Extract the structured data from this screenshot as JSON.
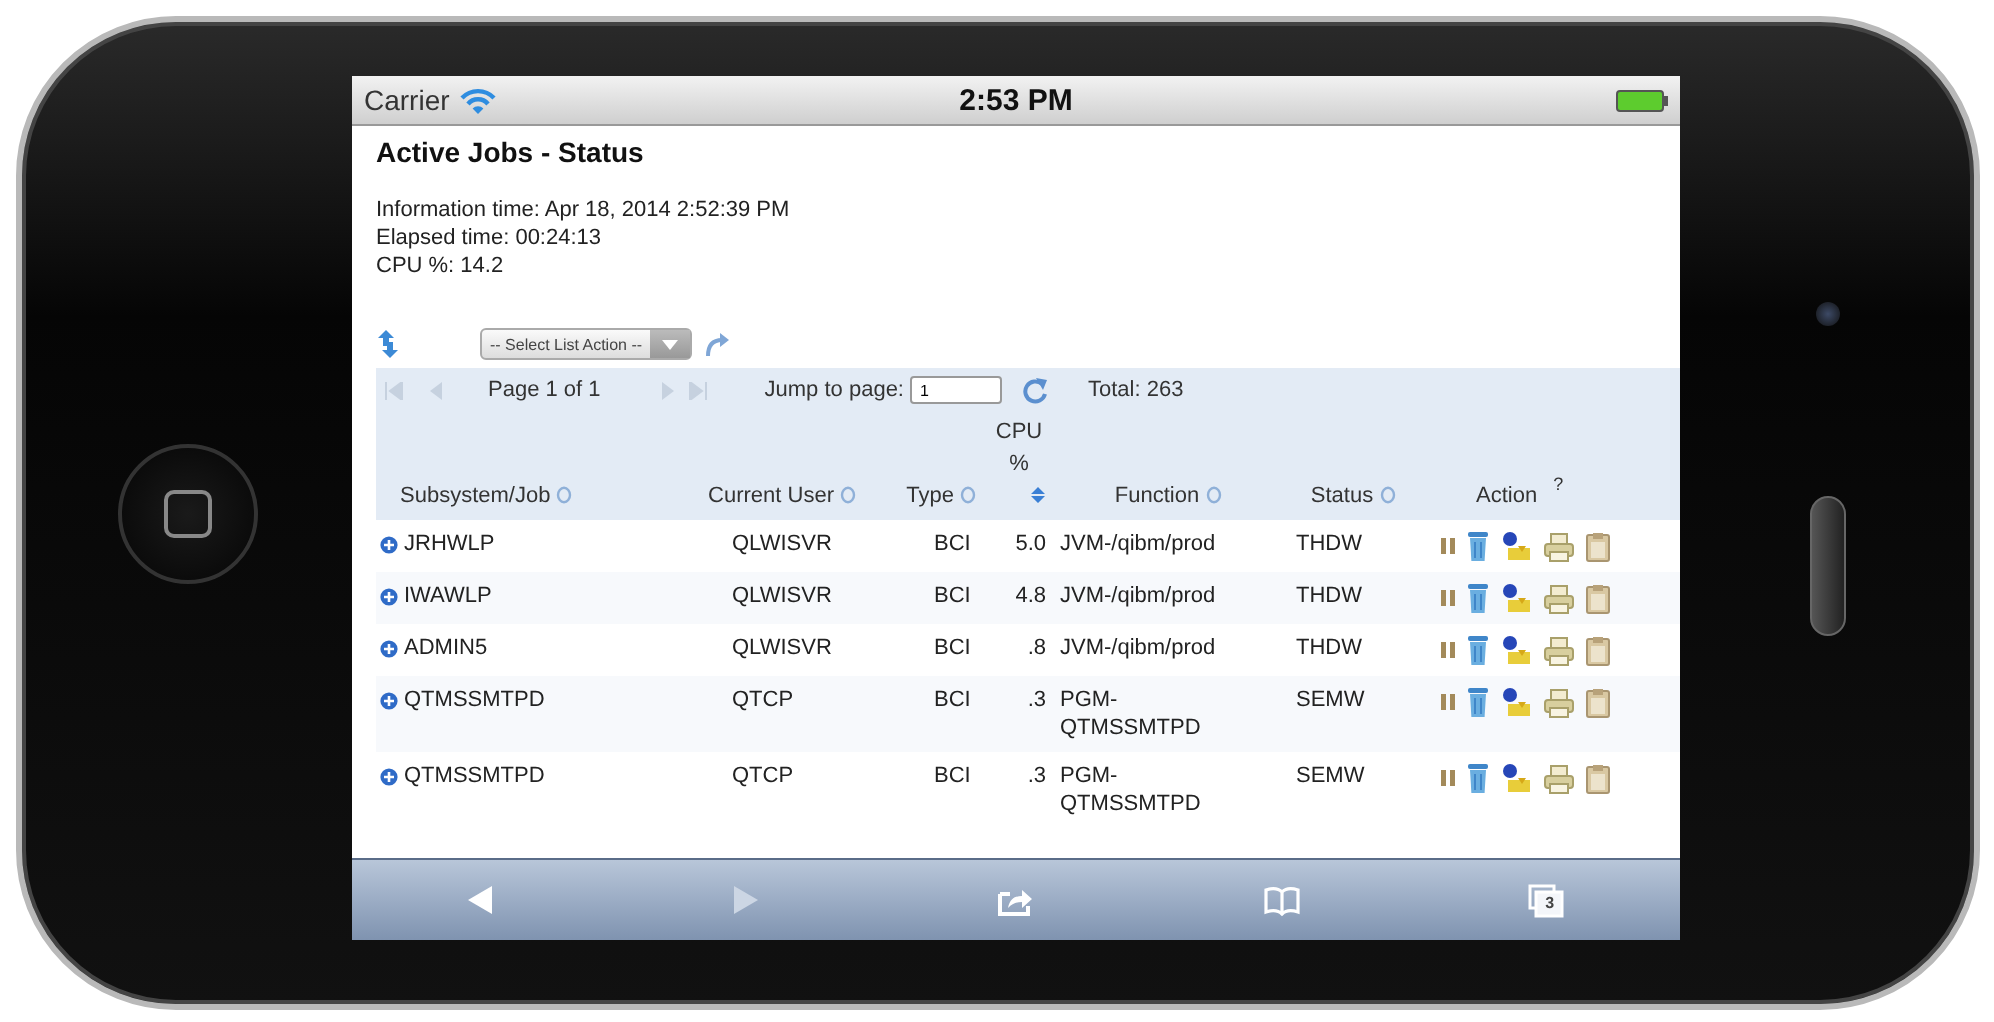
{
  "status_bar": {
    "carrier": "Carrier",
    "time": "2:53 PM"
  },
  "page": {
    "title": "Active Jobs - Status",
    "info": [
      "Information time: Apr 18, 2014 2:52:39 PM",
      "Elapsed time: 00:24:13",
      "CPU %: 14.2"
    ],
    "list_action": "-- Select List Action --"
  },
  "pager": {
    "page_label": "Page 1 of 1",
    "jump_label": "Jump to page:",
    "jump_value": "1",
    "total": "Total: 263"
  },
  "table": {
    "columns": [
      {
        "label": "Subsystem/Job",
        "kind": "sortable"
      },
      {
        "label": "Current User",
        "kind": "sortable"
      },
      {
        "label": "Type",
        "kind": "sortable"
      },
      {
        "label": "CPU %",
        "kind": "sorted"
      },
      {
        "label": "Function",
        "kind": "sortable"
      },
      {
        "label": "Status",
        "kind": "sortable"
      },
      {
        "label": "Action",
        "kind": "help",
        "help": "?"
      }
    ],
    "rows": [
      {
        "job": "JRHWLP",
        "user": "QLWISVR",
        "type": "BCI",
        "cpu": "5.0",
        "function": "JVM-/qibm/prod",
        "status": "THDW"
      },
      {
        "job": "IWAWLP",
        "user": "QLWISVR",
        "type": "BCI",
        "cpu": "4.8",
        "function": "JVM-/qibm/prod",
        "status": "THDW"
      },
      {
        "job": "ADMIN5",
        "user": "QLWISVR",
        "type": "BCI",
        "cpu": ".8",
        "function": "JVM-/qibm/prod",
        "status": "THDW"
      },
      {
        "job": "QTMSSMTPD",
        "user": "QTCP",
        "type": "BCI",
        "cpu": ".3",
        "function": "PGM-QTMSSMTPD",
        "status": "SEMW"
      },
      {
        "job": "QTMSSMTPD",
        "user": "QTCP",
        "type": "BCI",
        "cpu": ".3",
        "function": "PGM-QTMSSMTPD",
        "status": "SEMW"
      }
    ]
  },
  "browser_toolbar": [
    {
      "kind": "back",
      "disabled": false
    },
    {
      "kind": "forward",
      "disabled": true
    },
    {
      "kind": "share",
      "disabled": false
    },
    {
      "kind": "bookmarks",
      "disabled": false
    },
    {
      "kind": "tabs",
      "disabled": false,
      "count": "3"
    }
  ]
}
